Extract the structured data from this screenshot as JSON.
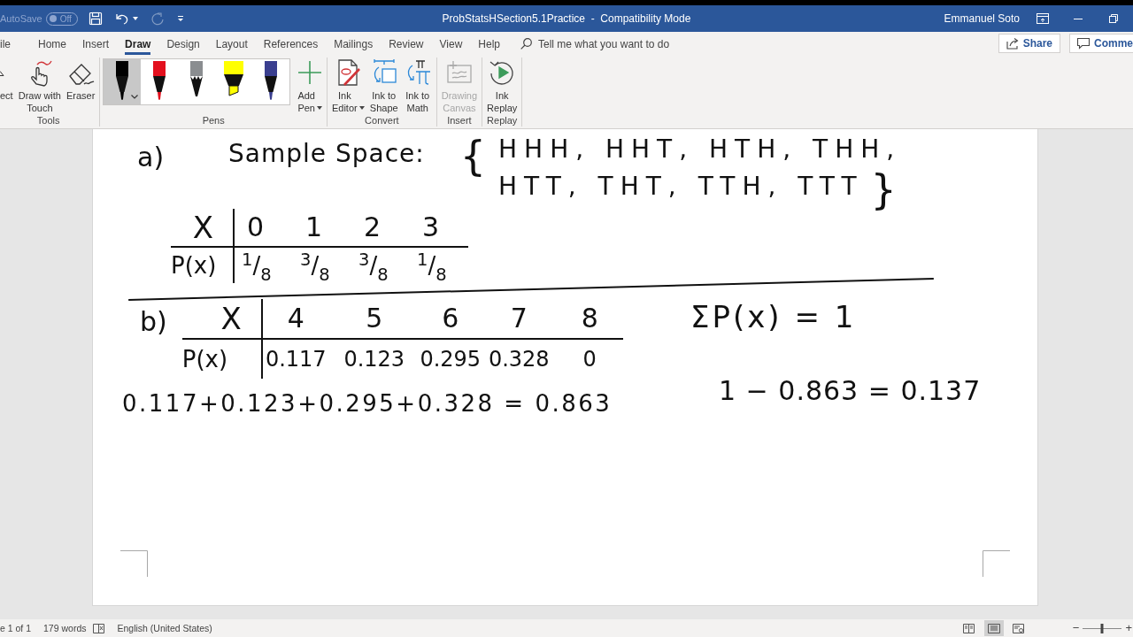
{
  "title_bar": {
    "autosave": {
      "label": "AutoSave",
      "state": "Off",
      "on": false
    },
    "quick_access": [
      {
        "kind": "save",
        "disabled": false,
        "dropdown": false
      },
      {
        "kind": "undo",
        "disabled": false,
        "dropdown": true
      },
      {
        "kind": "redo",
        "disabled": true,
        "dropdown": false
      },
      {
        "kind": "customize",
        "disabled": false,
        "dropdown": false
      }
    ],
    "title": "ProbStatsHSection5.1Practice  -  Compatibility Mode",
    "user": "Emmanuel Soto",
    "window_controls": [
      {
        "kind": "ribbon_options"
      },
      {
        "kind": "minimize"
      },
      {
        "kind": "restore"
      }
    ]
  },
  "ribbon_tabs": [
    {
      "label": "ile",
      "selected": false
    },
    {
      "label": "Home",
      "selected": false
    },
    {
      "label": "Insert",
      "selected": false
    },
    {
      "label": "Draw",
      "selected": true
    },
    {
      "label": "Design",
      "selected": false
    },
    {
      "label": "Layout",
      "selected": false
    },
    {
      "label": "References",
      "selected": false
    },
    {
      "label": "Mailings",
      "selected": false
    },
    {
      "label": "Review",
      "selected": false
    },
    {
      "label": "View",
      "selected": false
    },
    {
      "label": "Help",
      "selected": false
    }
  ],
  "tell_me": {
    "placeholder": "Tell me what you want to do"
  },
  "header_buttons": [
    {
      "kind": "share",
      "label": "Share"
    },
    {
      "kind": "comments",
      "label": "Comme"
    }
  ],
  "ribbon_groups": [
    {
      "label": "Tools",
      "buttons": [
        {
          "kind": "select",
          "label": "ect",
          "disabled": false,
          "dropdown": false
        },
        {
          "kind": "touch",
          "label": "Draw with Touch",
          "disabled": false,
          "dropdown": false
        },
        {
          "kind": "eraser",
          "label": "Eraser",
          "disabled": false,
          "dropdown": false
        }
      ]
    },
    {
      "label": "Pens",
      "pens": [
        {
          "kind": "pen",
          "color": "#000000",
          "selected": true
        },
        {
          "kind": "pen",
          "color": "#e3101e",
          "selected": false
        },
        {
          "kind": "pencil",
          "color": "#8a8d90",
          "selected": false
        },
        {
          "kind": "highlighter",
          "color": "#ffff00",
          "selected": false
        },
        {
          "kind": "pen",
          "color": "#3a3f8f",
          "selected": false
        }
      ],
      "buttons": [
        {
          "kind": "add_pen",
          "label": "Add Pen",
          "disabled": false,
          "dropdown": true
        }
      ]
    },
    {
      "label": "Convert",
      "buttons": [
        {
          "kind": "ink_editor",
          "label": "Ink Editor",
          "disabled": false,
          "dropdown": true
        },
        {
          "kind": "ink_to_shape",
          "label": "Ink to Shape",
          "disabled": false,
          "dropdown": false
        },
        {
          "kind": "ink_to_math",
          "label": "Ink to Math",
          "disabled": false,
          "dropdown": false
        }
      ]
    },
    {
      "label": "Insert",
      "buttons": [
        {
          "kind": "drawing_canvas",
          "label": "Drawing Canvas",
          "disabled": true,
          "dropdown": false
        }
      ]
    },
    {
      "label": "Replay",
      "buttons": [
        {
          "kind": "ink_replay",
          "label": "Ink Replay",
          "disabled": false,
          "dropdown": false
        }
      ]
    }
  ],
  "document": {
    "part_a": {
      "label": "a)",
      "sample_space": {
        "label": "Sample Space:",
        "open_brace": "{",
        "lines": [
          "HHH, HHT, HTH, THH,",
          "HTT, THT, TTH, TTT"
        ],
        "close_brace": "}"
      },
      "table": {
        "x_label": "X",
        "x_values": [
          "0",
          "1",
          "2",
          "3"
        ],
        "p_label": "P(x)",
        "p_values": [
          "$^{1}$/$_{8}$",
          "$^{3}$/$_{8}$",
          "$^{3}$/$_{8}$",
          "$^{1}$/$_{8}$"
        ]
      }
    },
    "part_b": {
      "label": "b)",
      "table": {
        "x_label": "X",
        "x_values": [
          "4",
          "5",
          "6",
          "7",
          "8"
        ],
        "p_label": "P(x)",
        "p_values": [
          "0.117",
          "0.123",
          "0.295",
          "0.328",
          "0"
        ]
      },
      "sum": "0.117+0.123+0.295+0.328 = 0.863",
      "total": "ΣP(x) = 1",
      "complement": "1 − 0.863 = 0.137"
    }
  },
  "status_bar": {
    "page": "e 1 of 1",
    "words": "179 words",
    "language": "English (United States)",
    "views": [
      {
        "kind": "read",
        "selected": false
      },
      {
        "kind": "print",
        "selected": true
      },
      {
        "kind": "web",
        "selected": false
      }
    ],
    "zoom": {
      "minus": "−",
      "plus": "+",
      "level": 0.5
    }
  }
}
